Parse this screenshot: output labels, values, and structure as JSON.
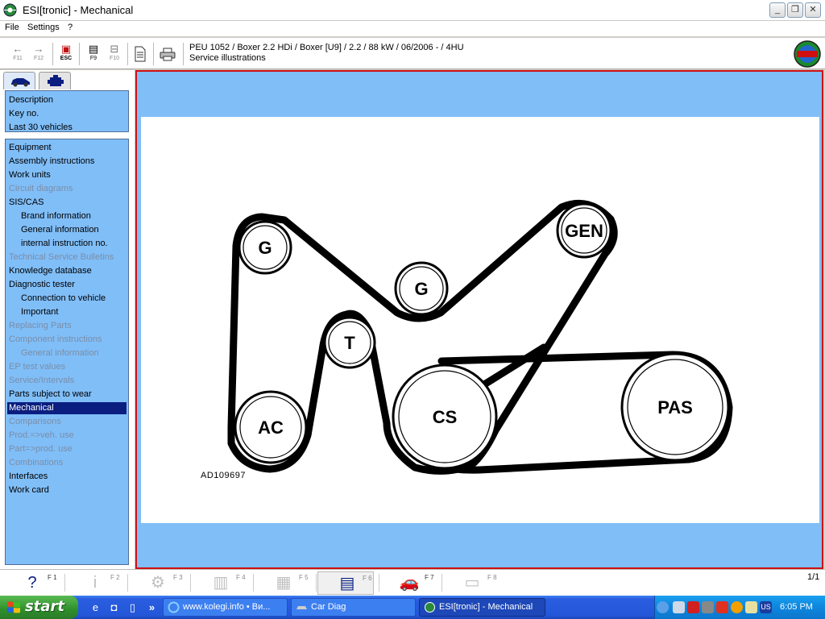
{
  "window": {
    "title": "ESI[tronic] - Mechanical",
    "buttons": {
      "minimize": "_",
      "restore": "❐",
      "close": "✕"
    }
  },
  "menu": [
    "File",
    "Settings",
    "?"
  ],
  "toolbar": {
    "buttons": [
      {
        "name": "back",
        "glyph": "←",
        "key": "F11"
      },
      {
        "name": "forward",
        "glyph": "→",
        "key": "F12"
      },
      {
        "name": "escape",
        "glyph": "▣",
        "key": "ESC"
      },
      {
        "name": "f9",
        "glyph": "▤",
        "key": "F9"
      },
      {
        "name": "f10",
        "glyph": "⊟",
        "key": "F10"
      }
    ],
    "vehicle": "PEU 1052 / Boxer 2.2 HDi / Boxer [U9] / 2.2 / 88 kW / 06/2006 -  / 4HU",
    "section": "Service illustrations"
  },
  "sidebar": {
    "top_items": [
      "Description",
      "Key no.",
      "Last 30 vehicles"
    ],
    "items": [
      {
        "label": "Equipment",
        "state": "enabled",
        "indent": false
      },
      {
        "label": "Assembly instructions",
        "state": "enabled",
        "indent": false
      },
      {
        "label": "Work units",
        "state": "enabled",
        "indent": false
      },
      {
        "label": "Circuit diagrams",
        "state": "disabled",
        "indent": false
      },
      {
        "label": "SIS/CAS",
        "state": "enabled",
        "indent": false
      },
      {
        "label": "Brand information",
        "state": "enabled",
        "indent": true
      },
      {
        "label": "General information",
        "state": "enabled",
        "indent": true
      },
      {
        "label": "internal instruction no.",
        "state": "enabled",
        "indent": true
      },
      {
        "label": "Technical Service Bulletins",
        "state": "disabled",
        "indent": false
      },
      {
        "label": "Knowledge database",
        "state": "enabled",
        "indent": false
      },
      {
        "label": "Diagnostic tester",
        "state": "enabled",
        "indent": false
      },
      {
        "label": "Connection to vehicle",
        "state": "enabled",
        "indent": true
      },
      {
        "label": "Important",
        "state": "enabled",
        "indent": true
      },
      {
        "label": "Replacing Parts",
        "state": "disabled",
        "indent": false
      },
      {
        "label": "Component instructions",
        "state": "disabled",
        "indent": false
      },
      {
        "label": "General information",
        "state": "disabled",
        "indent": true
      },
      {
        "label": "EP test values",
        "state": "disabled",
        "indent": false
      },
      {
        "label": "Service/Intervals",
        "state": "disabled",
        "indent": false
      },
      {
        "label": "Parts subject to wear",
        "state": "enabled",
        "indent": false
      },
      {
        "label": "Mechanical",
        "state": "selected",
        "indent": false
      },
      {
        "label": "Comparisons",
        "state": "disabled",
        "indent": false
      },
      {
        "label": "Prod.=>veh. use",
        "state": "disabled",
        "indent": false
      },
      {
        "label": "Part=>prod. use",
        "state": "disabled",
        "indent": false
      },
      {
        "label": "Combinations",
        "state": "disabled",
        "indent": false
      },
      {
        "label": "Interfaces",
        "state": "enabled",
        "indent": false
      },
      {
        "label": "Work card",
        "state": "enabled",
        "indent": false
      }
    ]
  },
  "illustration": {
    "code": "AD109697",
    "pulleys": [
      "G",
      "G",
      "GEN",
      "T",
      "AC",
      "CS",
      "PAS"
    ]
  },
  "function_bar": {
    "buttons": [
      {
        "name": "help",
        "glyph": "?",
        "key": "F 1",
        "state": "enabled"
      },
      {
        "name": "info",
        "glyph": "i",
        "key": "F 2",
        "state": "disabled"
      },
      {
        "name": "components",
        "glyph": "⚙",
        "key": "F 3",
        "state": "disabled"
      },
      {
        "name": "f4",
        "glyph": "▥",
        "key": "F 4",
        "state": "disabled"
      },
      {
        "name": "f5",
        "glyph": "▦",
        "key": "F 5",
        "state": "disabled"
      },
      {
        "name": "f6",
        "glyph": "▤",
        "key": "F 6",
        "state": "active"
      },
      {
        "name": "vehicle",
        "glyph": "🚗",
        "key": "F 7",
        "state": "enabled"
      },
      {
        "name": "f8",
        "glyph": "▭",
        "key": "F 8",
        "state": "disabled"
      }
    ],
    "page": "1/1"
  },
  "taskbar": {
    "start_label": "start",
    "quick_launch_more": "»",
    "tasks": [
      {
        "label": "www.kolegi.info • Ви...",
        "active": false
      },
      {
        "label": "Car Diag",
        "active": false
      },
      {
        "label": "ESI[tronic] - Mechanical",
        "active": true
      }
    ],
    "tray_lang": "US",
    "clock": "6:05 PM"
  },
  "colors": {
    "panel_blue": "#80bef8",
    "selected": "#0a1e80",
    "content_border": "#d01010",
    "disabled_text": "#7a8ea8"
  }
}
